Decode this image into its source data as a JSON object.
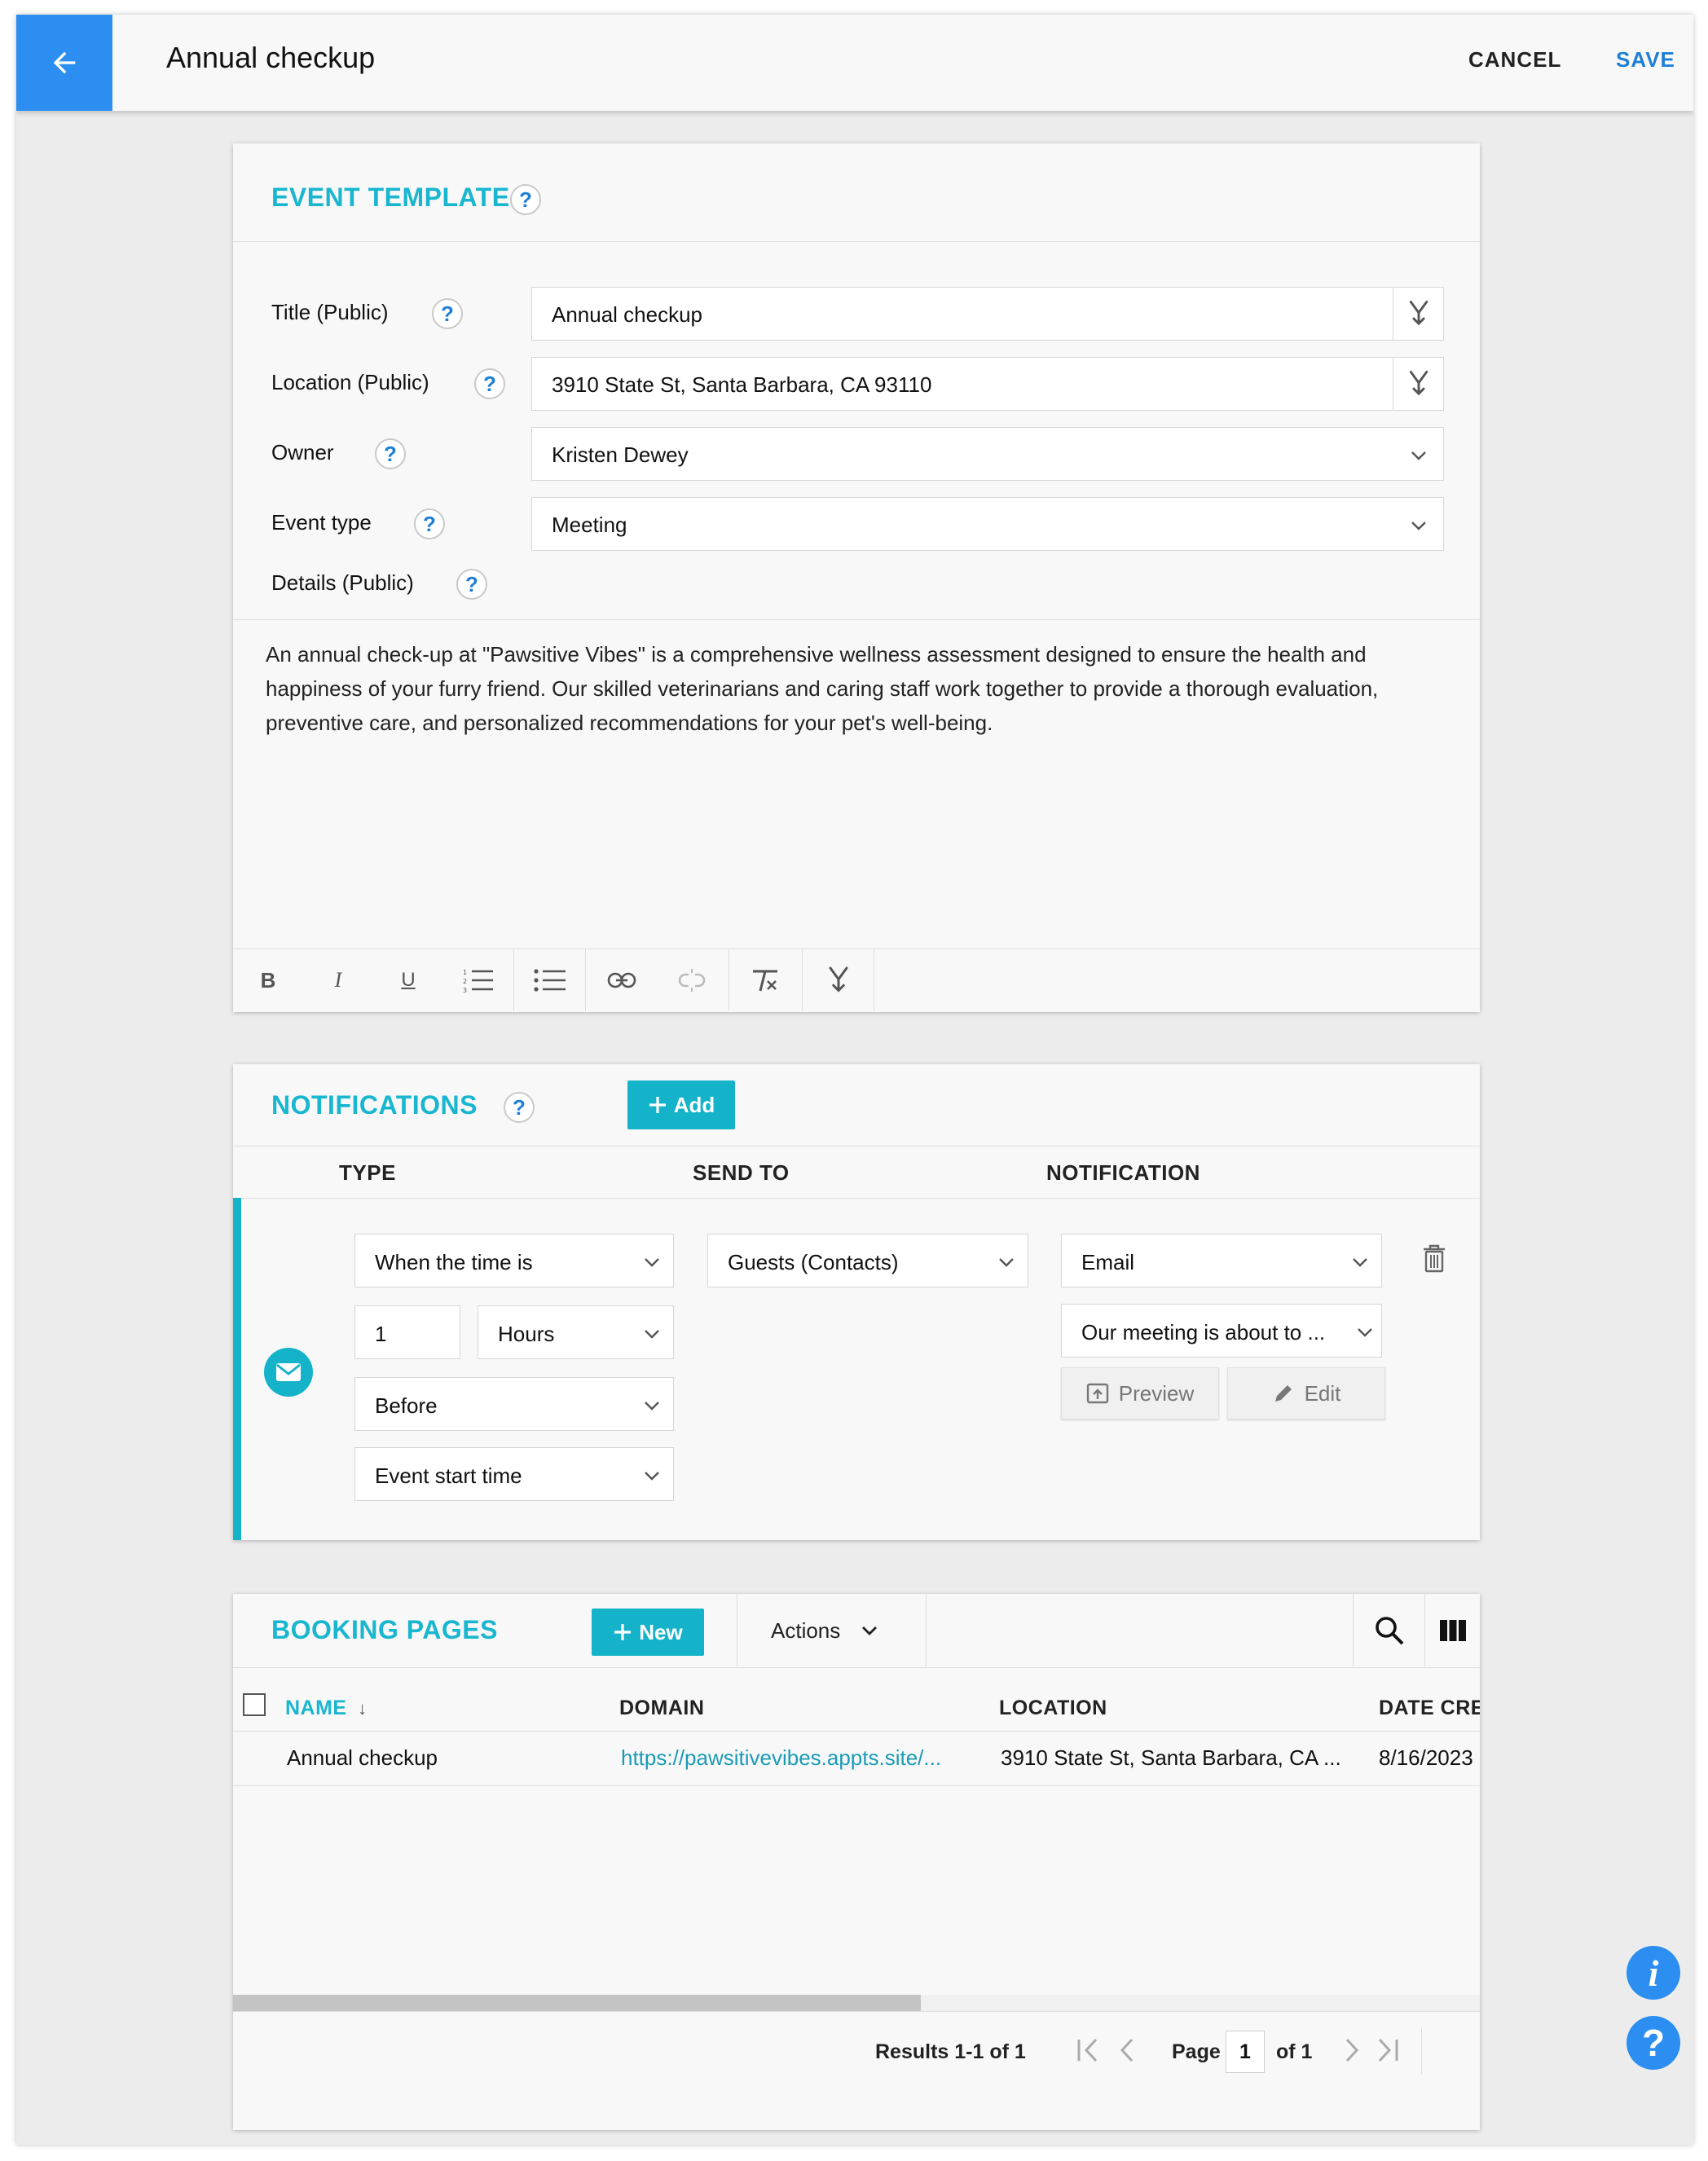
{
  "header": {
    "title": "Annual checkup",
    "cancel_label": "CANCEL",
    "save_label": "SAVE"
  },
  "event_template": {
    "section_title": "EVENT TEMPLATE",
    "fields": {
      "title": {
        "label": "Title (Public)",
        "value": "Annual checkup"
      },
      "location": {
        "label": "Location (Public)",
        "value": "3910 State St, Santa Barbara, CA 93110"
      },
      "owner": {
        "label": "Owner",
        "value": "Kristen Dewey"
      },
      "event_type": {
        "label": "Event type",
        "value": "Meeting"
      },
      "details": {
        "label": "Details (Public)"
      }
    },
    "description": "An annual check-up at \"Pawsitive Vibes\" is a comprehensive wellness assessment designed to ensure the health and happiness of your furry friend. Our skilled veterinarians and caring staff work together to provide a thorough evaluation, preventive care, and personalized recommendations for your pet's well-being.",
    "toolbar": [
      "bold-icon",
      "italic-icon",
      "underline-icon",
      "ordered-list-icon",
      "bullet-list-icon",
      "link-icon",
      "unlink-icon",
      "clear-format-icon",
      "merge-field-icon"
    ]
  },
  "notifications": {
    "section_title": "NOTIFICATIONS",
    "add_label": "Add",
    "columns": {
      "type": "TYPE",
      "send_to": "SEND TO",
      "notification": "NOTIFICATION"
    },
    "row": {
      "icon": "envelope-icon",
      "trigger": "When the time is",
      "amount": "1",
      "unit": "Hours",
      "relation": "Before",
      "reference": "Event start time",
      "send_to": "Guests (Contacts)",
      "channel": "Email",
      "template": "Our meeting is about to ...",
      "preview_label": "Preview",
      "edit_label": "Edit"
    },
    "accent": "#14b3c9"
  },
  "booking_pages": {
    "section_title": "BOOKING PAGES",
    "new_label": "New",
    "actions_label": "Actions",
    "columns": {
      "name": "NAME",
      "domain": "DOMAIN",
      "location": "LOCATION",
      "date_created": "DATE CREA"
    },
    "rows": [
      {
        "name": "Annual checkup",
        "domain": "https://pawsitivevibes.appts.site/...",
        "location": "3910 State St, Santa Barbara, CA ...",
        "date_created": "8/16/2023"
      }
    ],
    "pager": {
      "results": "Results 1-1 of 1",
      "page_label": "Page",
      "page": "1",
      "of_label": "of 1"
    }
  },
  "colors": {
    "brand_blue": "#2b8ef0",
    "teal": "#14b3c9",
    "link": "#1a9bb5"
  }
}
